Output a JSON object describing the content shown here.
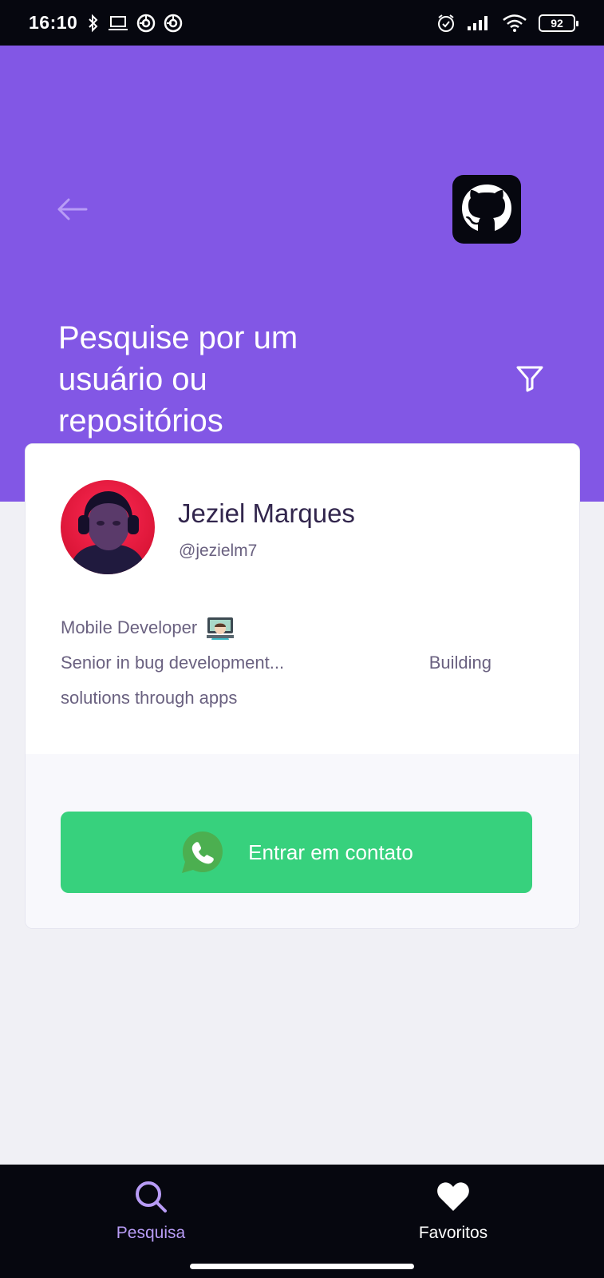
{
  "status_bar": {
    "time": "16:10",
    "battery": "92",
    "left_icons": [
      "bluetooth-icon",
      "laptop-icon",
      "sync-icon",
      "sync-icon"
    ],
    "right_icons": [
      "alarm-icon",
      "signal-icon",
      "wifi-icon",
      "battery-icon"
    ]
  },
  "header": {
    "title": "Pesquise por um usuário ou repositórios",
    "background_color": "#8257e5",
    "icons": [
      "back-arrow-icon",
      "github-icon",
      "filter-icon"
    ]
  },
  "profile": {
    "name": "Jeziel Marques",
    "login": "@jezielm7",
    "bio_line1": "Mobile Developer",
    "bio_line2_part1": "Senior in bug development...",
    "bio_line2_part2": "Building",
    "bio_line3": "solutions through apps"
  },
  "contact": {
    "label": "Entrar em contato",
    "icon": "whatsapp-icon",
    "color": "#37d17d"
  },
  "bottom_nav": {
    "items": [
      {
        "label": "Pesquisa",
        "icon": "search-icon",
        "active": true
      },
      {
        "label": "Favoritos",
        "icon": "heart-icon",
        "active": false
      }
    ]
  }
}
